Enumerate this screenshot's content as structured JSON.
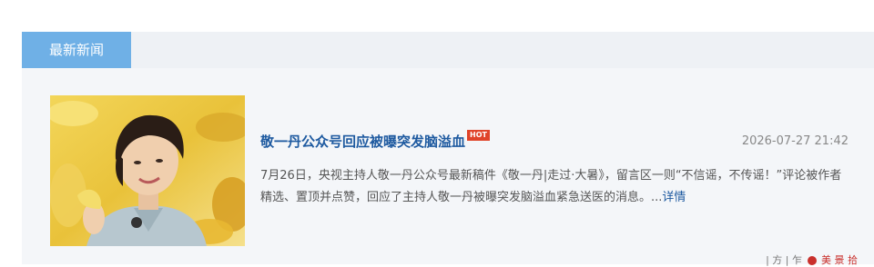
{
  "section": {
    "tab_label": "最新新闻"
  },
  "news": {
    "title": "敬一丹公众号回应被曝突发脑溢血",
    "badge": "HOT",
    "date": "2026-07-27 21:42",
    "summary": "7月26日，央视主持人敬一丹公众号最新稿件《敬一丹|走过·大暑》，留言区一则“不信谣，不传谣！”评论被作者精选、置顶并点赞，回应了主持人敬一丹被曝突发脑溢血紧急送医的消息。...",
    "detail_label": "详情"
  },
  "footer": {
    "fragment_text": "| 方 | 乍",
    "seal_text": "美 景 拾"
  },
  "colors": {
    "tab_bg": "#6fb0e6",
    "title": "#1e5aa0",
    "badge": "#e0442a"
  }
}
